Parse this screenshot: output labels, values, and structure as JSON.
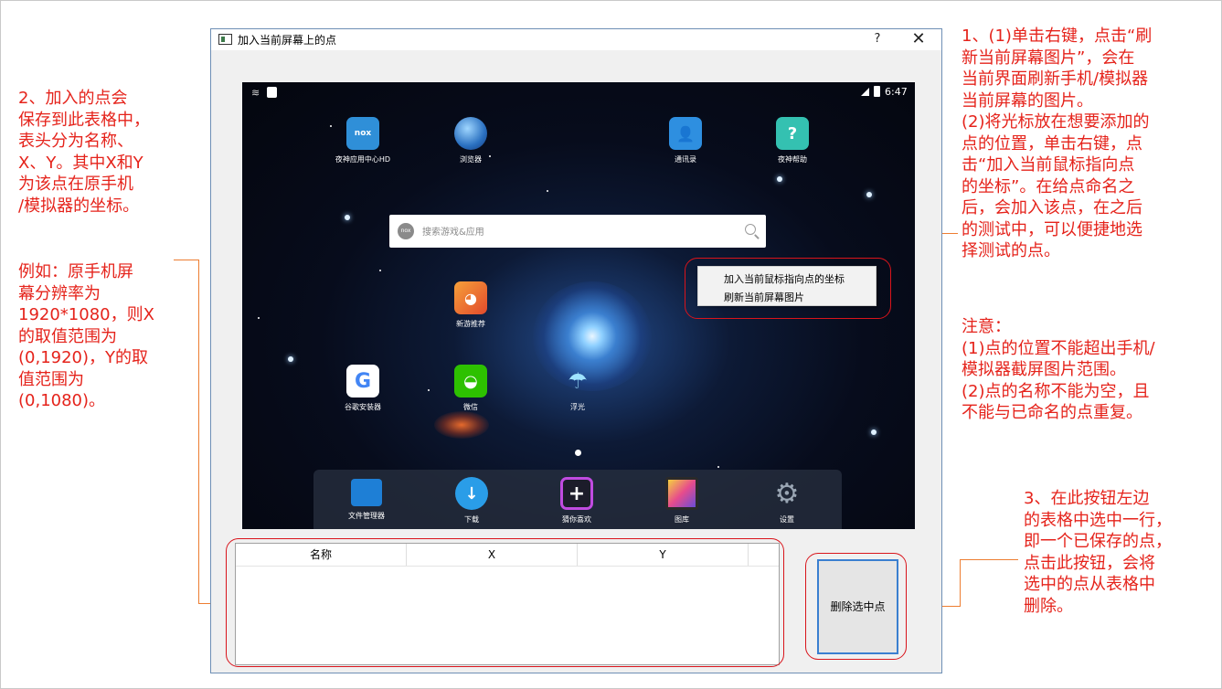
{
  "dialog": {
    "title": "加入当前屏幕上的点",
    "help_label": "?",
    "close_label": "✕"
  },
  "emulator": {
    "status_time": "6:47",
    "search_placeholder": "搜索游戏&应用",
    "search_logo": "nox",
    "apps": [
      {
        "label": "夜神应用中心HD",
        "icon": "nox-appcenter-icon"
      },
      {
        "label": "浏览器",
        "icon": "browser-globe-icon"
      },
      {
        "label": "通讯录",
        "icon": "contacts-icon"
      },
      {
        "label": "夜神帮助",
        "icon": "help-icon"
      },
      {
        "label": "新游推荐",
        "icon": "new-games-icon"
      },
      {
        "label": "谷歌安装器",
        "icon": "google-installer-icon"
      },
      {
        "label": "微信",
        "icon": "wechat-icon"
      },
      {
        "label": "浮光",
        "icon": "jellyfish-icon"
      }
    ],
    "dock": [
      {
        "label": "文件管理器",
        "icon": "folder-icon"
      },
      {
        "label": "下载",
        "icon": "download-icon"
      },
      {
        "label": "猜你喜欢",
        "icon": "plus-icon"
      },
      {
        "label": "图库",
        "icon": "gallery-icon"
      },
      {
        "label": "设置",
        "icon": "settings-gear-icon"
      }
    ]
  },
  "context_menu": {
    "items": [
      "加入当前鼠标指向点的坐标",
      "刷新当前屏幕图片"
    ]
  },
  "points_table": {
    "columns": [
      "名称",
      "X",
      "Y"
    ]
  },
  "delete_button": {
    "label": "删除选中点"
  },
  "annotations": {
    "left_top": "2、加入的点会\n保存到此表格中，\n表头分为名称、\nX、Y。其中X和Y\n为该点在原手机\n/模拟器的坐标。",
    "left_bottom": "例如：原手机屏\n幕分辨率为\n1920*1080，则X\n的取值范围为\n(0,1920)，Y的取\n值范围为\n(0,1080)。",
    "right_top": "1、(1)单击右键，点击“刷\n新当前屏幕图片”，会在\n当前界面刷新手机/模拟器\n当前屏幕的图片。\n(2)将光标放在想要添加的\n点的位置，单击右键，点\n击“加入当前鼠标指向点\n的坐标”。在给点命名之\n后，会加入该点，在之后\n的测试中，可以便捷地选\n择测试的点。",
    "right_mid": "注意：\n(1)点的位置不能超出手机/\n模拟器截屏图片范围。\n(2)点的名称不能为空，且\n不能与已命名的点重复。",
    "right_bottom": "3、在此按钮左边\n的表格中选中一行，\n即一个已保存的点，\n点击此按钮，会将\n选中的点从表格中\n删除。"
  },
  "colors": {
    "annotation_text": "#e5231b",
    "highlight_ring": "#d9141b",
    "callout_line": "#ed7d31",
    "button_focus_border": "#3a7fd0"
  }
}
